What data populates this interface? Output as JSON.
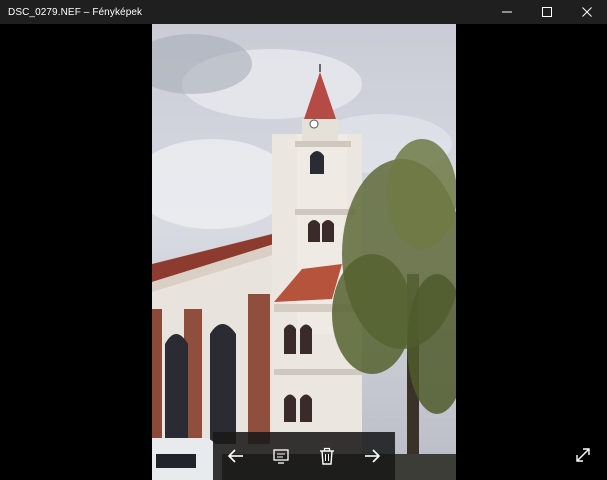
{
  "window": {
    "title": "DSC_0279.NEF – Fényképek",
    "controls": [
      "minimize-icon",
      "maximize-icon",
      "close-icon"
    ]
  },
  "photo": {
    "subject": "church-photo"
  },
  "toolbar": {
    "icons": [
      "arrow-left-icon",
      "slideshow-icon",
      "delete-icon",
      "arrow-right-icon"
    ]
  },
  "colors": {
    "titlebar_bg": "#1f1f1f",
    "viewer_bg": "#000000",
    "toolbar_bg": "#191919",
    "icon": "#ffffff"
  }
}
